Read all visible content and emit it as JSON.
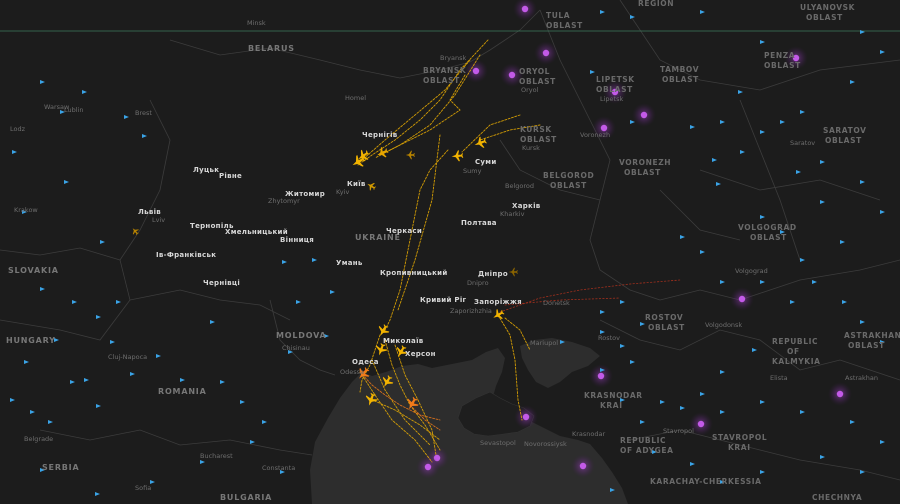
{
  "map": {
    "colors": {
      "land": "#1c1c1c",
      "sea": "#2e2e2e",
      "border": "#3c3c3c",
      "bounds_line": "#3d7a5e",
      "track_yellow": "#f2b300",
      "track_orange": "#f07a1a",
      "track_red": "#d9381e",
      "radar": "#b04ad8",
      "aircraft_marker": "#3aa3e6"
    },
    "labels": {
      "ukraine": [
        "Чернігів",
        "Київ",
        "Суми",
        "Харків",
        "Житомир",
        "Луцьк",
        "Рівне",
        "Львів",
        "Тернопіль",
        "Хмельницький",
        "Вінниця",
        "Черкаси",
        "Полтава",
        "Умань",
        "Кропивницький",
        "Дніпро",
        "Кривий Ріг",
        "Запоріжжя",
        "Миколаїв",
        "Херсон",
        "Одеса",
        "Чернівці",
        "Ів-Франківськ"
      ],
      "countries": [
        "BELARUS",
        "UKRAINE",
        "SLOVAKIA",
        "HUNGARY",
        "ROMANIA",
        "MOLDOVA",
        "SERBIA",
        "BULGARIA",
        "REPUBLIC OF KALMYKIA",
        "REPUBLIC OF ADYGEA",
        "KARACHAY-CHERKESSIA",
        "CHECHNYA"
      ],
      "regions": [
        "BRYANSK OBLAST",
        "ORYOL OBLAST",
        "KURSK OBLAST",
        "LIPETSK OBLAST",
        "TAMBOV OBLAST",
        "PENZA OBLAST",
        "SARATOV OBLAST",
        "VORONEZH OBLAST",
        "BELGOROD OBLAST",
        "VOLGOGRAD OBLAST",
        "ROSTOV OBLAST",
        "ASTRAKHAN OBLAST",
        "KRASNODAR KRAI",
        "STAVROPOL KRAI",
        "TULA OBLAST",
        "ULYANOVSK OBLAST",
        "REGION"
      ],
      "minor": [
        "Minsk",
        "Bryansk",
        "Oryol",
        "Kursk",
        "Lipetsk",
        "Voronezh",
        "Saratov",
        "Belgorod",
        "Kharkiv",
        "Sumy",
        "Kyiv",
        "Homel",
        "Warsaw",
        "Lublin",
        "Lodz",
        "Krakow",
        "Lviv",
        "Brest",
        "Zhytomyr",
        "Dnipro",
        "Zaporizhzhia",
        "Donetsk",
        "Volgograd",
        "Volgodonsk",
        "Elista",
        "Krasnodar",
        "Stavropol",
        "Mariupol",
        "Rostov",
        "Cluj-Napoca",
        "Bucharest",
        "Constanta",
        "Belgrade",
        "Sofia",
        "Chisinau",
        "Odessa",
        "Sevastopol",
        "Novorossiysk",
        "Astrakhan"
      ]
    }
  }
}
